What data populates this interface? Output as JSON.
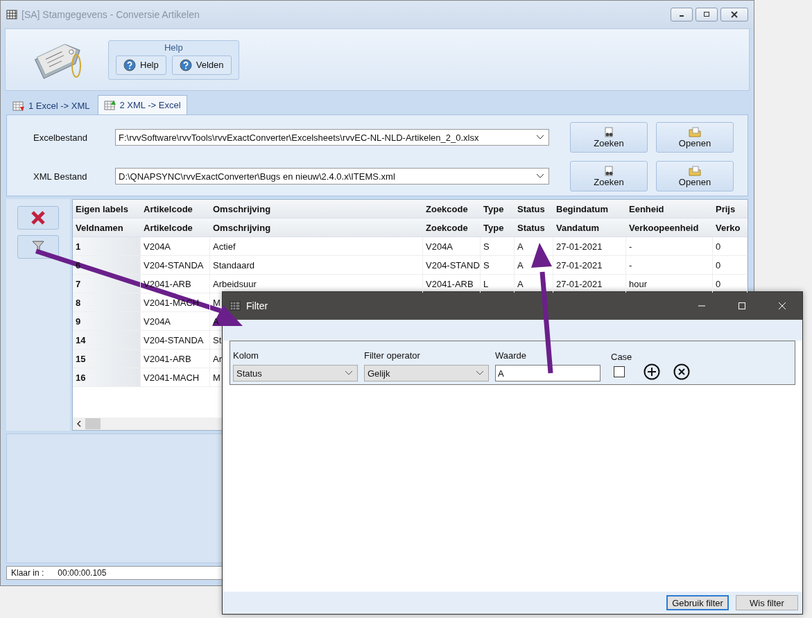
{
  "window": {
    "title": "[SA]  Stamgegevens - Conversie Artikelen"
  },
  "ribbon": {
    "group_label": "Help",
    "buttons": [
      "Help",
      "Velden"
    ]
  },
  "tabs": [
    {
      "label": "1 Excel -> XML",
      "selected": false
    },
    {
      "label": "2 XML -> Excel",
      "selected": true
    }
  ],
  "files": [
    {
      "label": "Excelbestand",
      "value": "F:\\rvvSoftware\\rvvTools\\rvvExactConverter\\Excelsheets\\rvvEC-NL-NLD-Artikelen_2_0.xlsx",
      "buttons": [
        "Zoeken",
        "Openen"
      ]
    },
    {
      "label": "XML Bestand",
      "value": "D:\\QNAPSYNC\\rvvExactConverter\\Bugs en nieuw\\2.4.0.x\\ITEMS.xml",
      "buttons": [
        "Zoeken",
        "Openen"
      ]
    }
  ],
  "table": {
    "header_rows": [
      [
        "Eigen labels",
        "Artikelcode",
        "Omschrijving",
        "Zoekcode",
        "Type",
        "Status",
        "Begindatum",
        "Eenheid",
        "Prijs"
      ],
      [
        "Veldnamen",
        "Artikelcode",
        "Omschrijving",
        "Zoekcode",
        "Type",
        "Status",
        "Vandatum",
        "Verkoopeenheid",
        "Verko"
      ]
    ],
    "rows": [
      [
        "1",
        "V204A",
        "Actief",
        "V204A",
        "S",
        "A",
        "27-01-2021",
        "-",
        "0"
      ],
      [
        "6",
        "V204-STANDA",
        "Standaard",
        "V204-STAND",
        "S",
        "A",
        "27-01-2021",
        "-",
        "0"
      ],
      [
        "7",
        "V2041-ARB",
        "Arbeidsuur",
        "V2041-ARB",
        "L",
        "A",
        "27-01-2021",
        "hour",
        "0"
      ],
      [
        "8",
        "V2041-MACH",
        "M"
      ],
      [
        "9",
        "V204A",
        "A"
      ],
      [
        "14",
        "V204-STANDA",
        "St"
      ],
      [
        "15",
        "V2041-ARB",
        "Ar"
      ],
      [
        "16",
        "V2041-MACH",
        "M"
      ]
    ]
  },
  "status_bar": {
    "label": "Klaar in :",
    "value": "00:00:00.105"
  },
  "filter_dialog": {
    "title": "Filter",
    "fields": [
      {
        "kind": "select",
        "label": "Kolom",
        "value": "Status"
      },
      {
        "kind": "select",
        "label": "Filter operator",
        "value": "Gelijk"
      },
      {
        "kind": "text",
        "label": "Waarde",
        "value": "A"
      },
      {
        "kind": "checkbox",
        "label": "Case",
        "checked": false
      }
    ],
    "buttons": [
      {
        "label": "Gebruik filter",
        "default": true
      },
      {
        "label": "Wis filter",
        "default": false
      }
    ]
  }
}
